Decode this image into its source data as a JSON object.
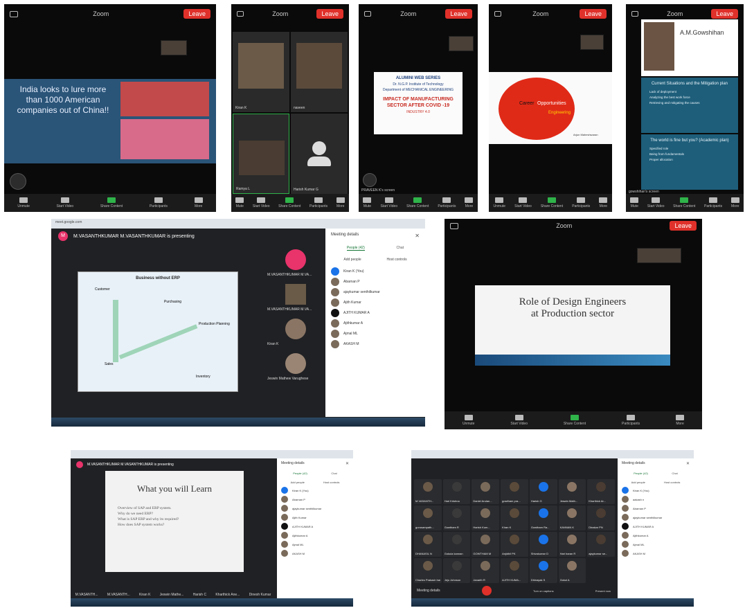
{
  "shot1": {
    "title": "Zoom",
    "leave": "Leave",
    "slide_text": "India looks to lure more than 1000 American companies out of China!!",
    "toolbar": [
      "Unmute",
      "Start Video",
      "Share Content",
      "Participants",
      "More"
    ]
  },
  "shot2": {
    "title": "Zoom",
    "leave": "Leave",
    "tiles": [
      "Kiran K",
      "naveen",
      "Ramya L",
      "Harish Kumar G"
    ],
    "toolbar": [
      "Mute",
      "Start Video",
      "Share Content",
      "Participants",
      "More"
    ]
  },
  "shot3": {
    "title": "Zoom",
    "leave": "Leave",
    "slide": {
      "series": "ALUMINI WEB SERIES",
      "institute": "Dr. N.G.P. Institute of Technology",
      "dept": "Department of MECHANICAL ENGINEERING",
      "heading": "IMPACT OF MANUFACTURING SECTOR AFTER COVID -19",
      "sub": "INDUSTRY 4.0"
    },
    "screen_label": "PRAVEEN K's screen",
    "toolbar": [
      "Mute",
      "Start Video",
      "Share Content",
      "Participants",
      "More"
    ]
  },
  "shot4": {
    "title": "Zoom",
    "leave": "Leave",
    "slide": {
      "w1": "Career",
      "w2": "Opportunities",
      "w3": "Engineering",
      "author": "Arjun Maheshwaran"
    },
    "toolbar": [
      "Unmute",
      "Start Video",
      "Share Content",
      "Participants",
      "More"
    ]
  },
  "shot5": {
    "title": "Zoom",
    "leave": "Leave",
    "presenter": "A.M.Gowshihan",
    "box1_title": "Current Situations and the Mitigation plan",
    "box1_items": [
      "Lack of deployment",
      "Analyzing the best work force",
      "Retrieving and mitigating the causes"
    ],
    "box2_title": "The world is fine but you? (Academic plan)",
    "box2_items": [
      "Specified role",
      "Being from fundamentals",
      "Proper allocation"
    ],
    "screen_label": "gowshihan's screen",
    "toolbar": [
      "Mute",
      "Start Video",
      "Share Content",
      "Participants",
      "More"
    ]
  },
  "shot6": {
    "presenting": "M.VASANTHKUMAR M.VASANTHKUMAR is presenting",
    "url": "meet.google.com",
    "slide_title": "Business without ERP",
    "diagram": [
      "Customer",
      "Purchasing",
      "Production Planning",
      "Inventory",
      "Sales"
    ],
    "tiles": [
      "M.VASANTHKUMAR M.VA...",
      "M.VASANTHKUMAR M.VA...",
      "Kiran K",
      "Jeswin Mathew Varughese"
    ],
    "panel_title": "Meeting details",
    "tab_people": "People (42)",
    "tab_chat": "Chat",
    "add_people": "Add people",
    "host_controls": "Host controls",
    "people": [
      "Kiran K (You)",
      "Abarnan P",
      "ajaykumar senthilkumar",
      "Ajith Kumar",
      "AJITH KUMAR A",
      "Ajithkumar A",
      "Ajmal ML",
      "AKASH M"
    ]
  },
  "shot7": {
    "title": "Zoom",
    "leave": "Leave",
    "slide_line1": "Role of Design Engineers",
    "slide_line2": "at Production sector",
    "toolbar": [
      "Unmute",
      "Start Video",
      "Share Content",
      "Participants",
      "More"
    ]
  },
  "shot8": {
    "presenting": "M.VASANTHKUMAR M.VASANTHKUMAR is presenting",
    "slide_title": "What you will Learn",
    "bullets": [
      "Overview of SAP and ERP system.",
      "Why do we need ERP?",
      "What is SAP ERP and why its required?",
      "How does SAP system works?"
    ],
    "bottom_tiles": [
      "M.VASANTH...",
      "M.VASANTH...",
      "Kiran K",
      "Jeswin Mathe...",
      "Harish C",
      "Kharthick Ane...",
      "Dinesh Kumar"
    ],
    "panel_title": "Meeting details",
    "tab_people": "People (42)",
    "tab_chat": "Chat",
    "add_people": "Add people",
    "host_controls": "Host controls",
    "people": [
      "Kiran K (You)",
      "Abarnan P",
      "ajaykumar senthilkumar",
      "Ajith Kumar",
      "AJITH KUMAR A",
      "Ajithkumar A",
      "Ajmal ML",
      "AKASH M"
    ]
  },
  "shot9": {
    "grid_names": [
      "M.VASANTH...",
      "Hari Krishna",
      "Daniel Arulan...",
      "gowtham pra...",
      "Harish G",
      "Jeswin Math...",
      "Kharthick Ar...",
      "gurusampath...",
      "Gowtham R",
      "Harish Kum...",
      "Kiran K",
      "Gowtham Ra...",
      "KANNAN K",
      "Dinakar PN",
      "DHANASIL N",
      "Gokula kannan",
      "GOWTHAM M",
      "Anjidhil PK",
      "Shivakumar D",
      "Hari haran R",
      "ajaykumar se...",
      "Charles Prakash has left the meeting",
      "Jeju Johnson",
      "Janarth R",
      "AJITH KUMA...",
      "Dhinayak S",
      "Gokul A"
    ],
    "bottom_left": "Meeting details",
    "turn_on_captions": "Turn on captions",
    "present_now": "Present now",
    "panel_title": "Meeting details",
    "tab_people": "People (42)",
    "tab_chat": "Chat",
    "add_people": "Add people",
    "host_controls": "Host controls",
    "people": [
      "Kiran K (You)",
      "aakash n",
      "Abarnan P",
      "ajaykumar senthilkumar",
      "AJITH KUMAR A",
      "Ajithkumar A",
      "Ajmal ML",
      "AKASH M"
    ]
  }
}
